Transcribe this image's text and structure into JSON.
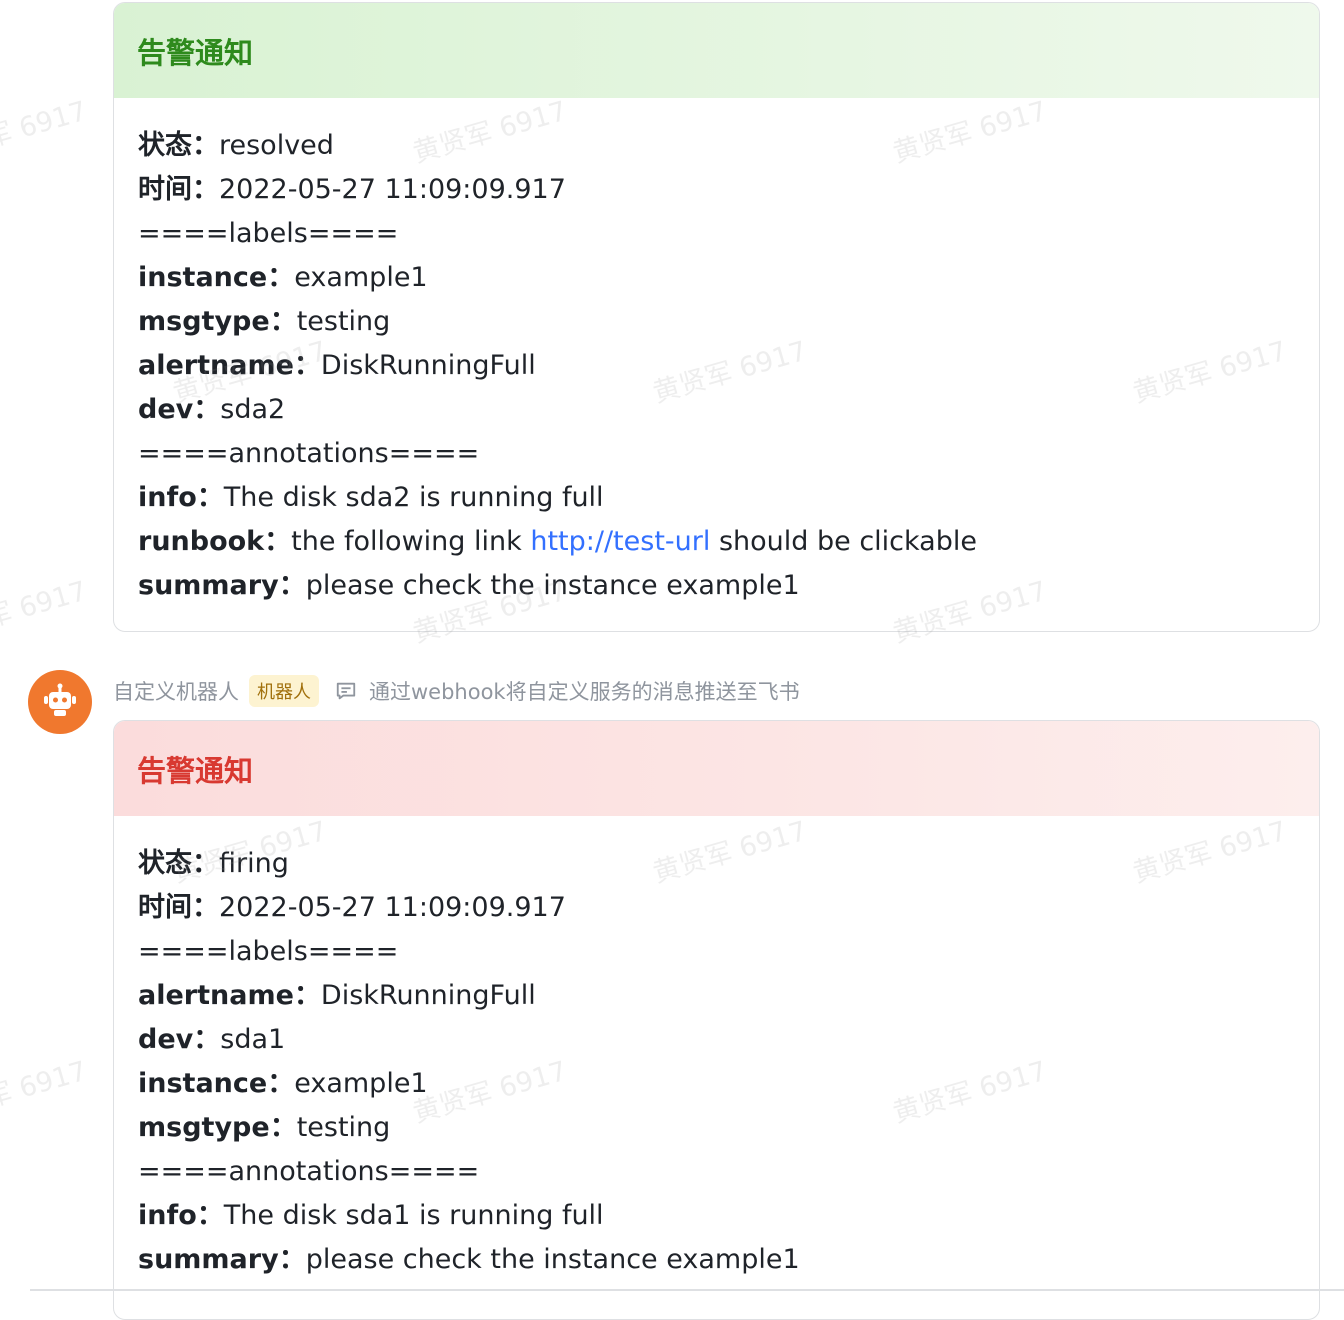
{
  "messages": [
    {
      "title": "告警通知",
      "status_color": "#2e8a1d",
      "lines": [
        {
          "key": "状态",
          "value": "resolved"
        },
        {
          "key": "时间",
          "value": "2022-05-27 11:09:09.917"
        },
        {
          "raw": "====labels===="
        },
        {
          "key": "instance",
          "value": "example1"
        },
        {
          "key": "msgtype",
          "value": "testing"
        },
        {
          "key": "alertname",
          "value": "DiskRunningFull"
        },
        {
          "key": "dev",
          "value": "sda2"
        },
        {
          "raw": "====annotations===="
        },
        {
          "key": "info",
          "value": "The disk sda2 is running full"
        },
        {
          "key": "runbook",
          "value_pre": "the following link ",
          "link": "http://test-url",
          "value_post": " should be clickable"
        },
        {
          "key": "summary",
          "value": "please check the instance example1"
        }
      ]
    },
    {
      "title": "告警通知",
      "status_color": "#d83931",
      "lines": [
        {
          "key": "状态",
          "value": "firing"
        },
        {
          "key": "时间",
          "value": "2022-05-27 11:09:09.917"
        },
        {
          "raw": "====labels===="
        },
        {
          "key": "alertname",
          "value": "DiskRunningFull"
        },
        {
          "key": "dev",
          "value": "sda1"
        },
        {
          "key": "instance",
          "value": "example1"
        },
        {
          "key": "msgtype",
          "value": "testing"
        },
        {
          "raw": "====annotations===="
        },
        {
          "key": "info",
          "value": "The disk sda1 is running full"
        },
        {
          "key": "summary",
          "value": "please check the instance example1"
        }
      ]
    }
  ],
  "sender": {
    "name": "自定义机器人",
    "badge": "机器人",
    "description": "通过webhook将自定义服务的消息推送至飞书",
    "avatar_icon": "robot-icon"
  },
  "watermark_text": "黄贤军 6917",
  "colors": {
    "link": "#3370ff",
    "avatar_bg": "#f0782e"
  }
}
